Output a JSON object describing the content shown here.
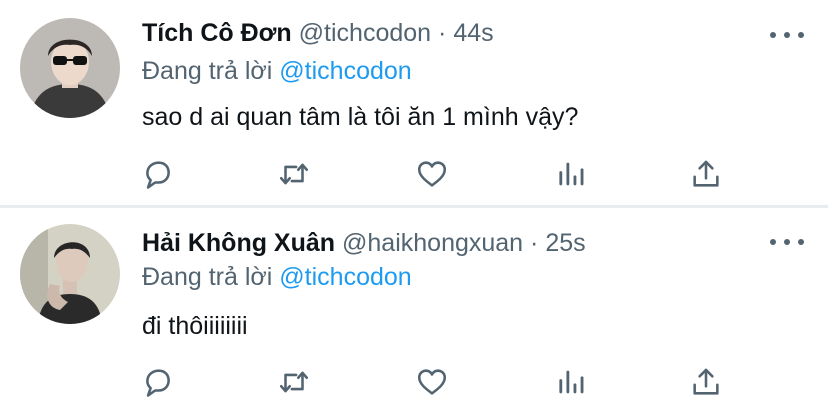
{
  "tweets": [
    {
      "name": "Tích Cô Đơn",
      "handle": "@tichcodon",
      "separator": "·",
      "time": "44s",
      "reply_prefix": "Đang trả lời",
      "reply_to": "@tichcodon",
      "text": "sao d ai quan tâm là tôi ăn 1 mình vậy?"
    },
    {
      "name": "Hải Không Xuân",
      "handle": "@haikhongxuan",
      "separator": "·",
      "time": "25s",
      "reply_prefix": "Đang trả lời",
      "reply_to": "@tichcodon",
      "text": "đi thôiiiiiiii"
    }
  ],
  "icons": {
    "reply": "reply-icon",
    "retweet": "retweet-icon",
    "like": "heart-icon",
    "analytics": "analytics-icon",
    "share": "share-icon",
    "more": "more-icon"
  },
  "colors": {
    "text": "#0f1419",
    "secondary": "#536471",
    "accent": "#1d9bf0",
    "divider": "#e6ecf0"
  }
}
